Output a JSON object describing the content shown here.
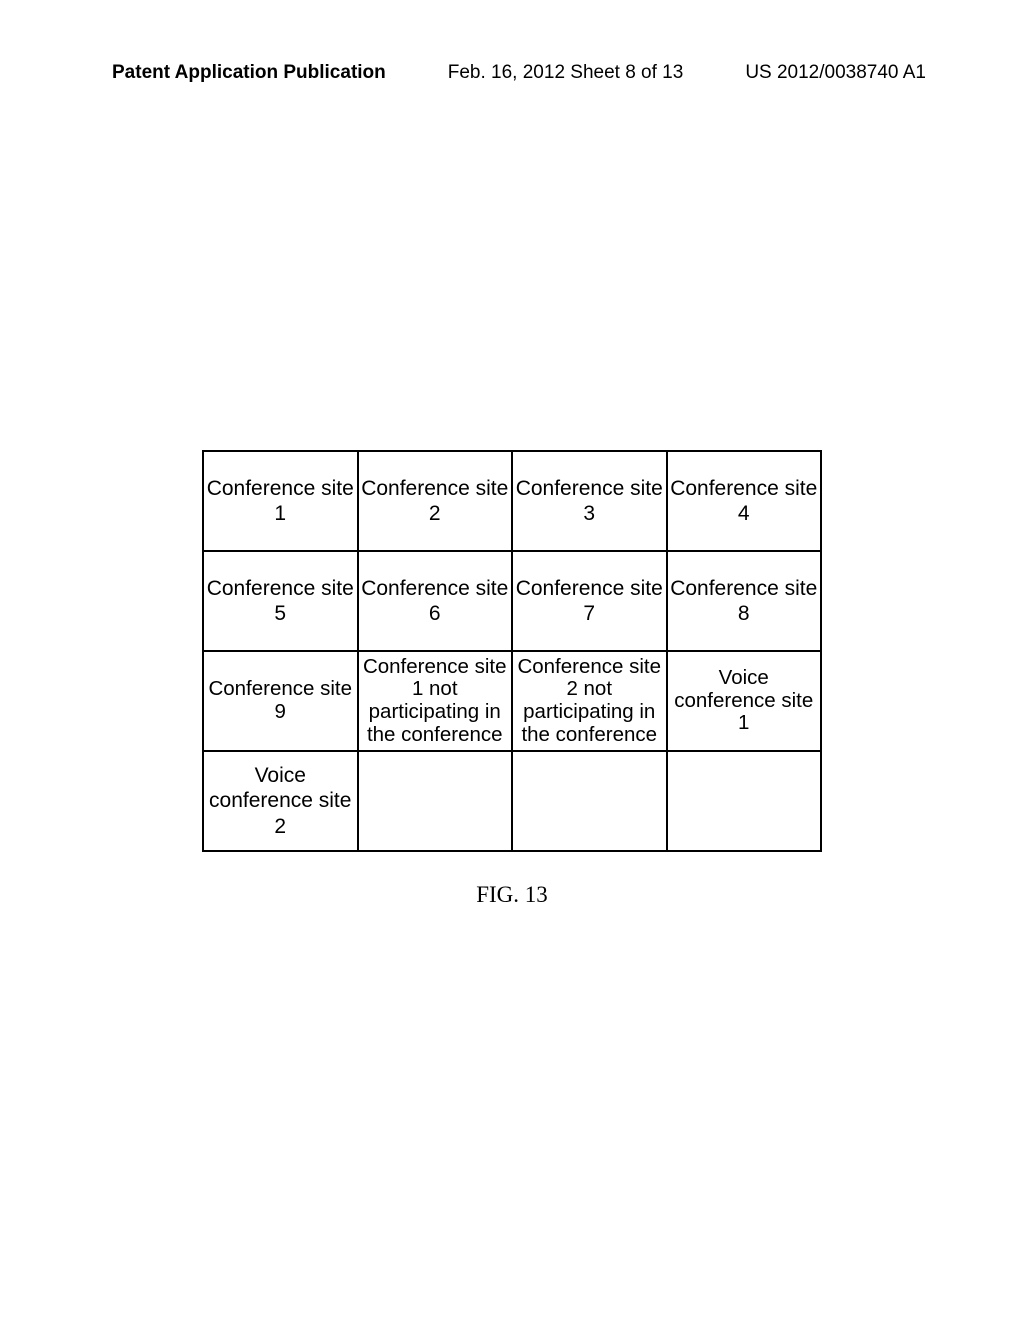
{
  "header": {
    "left": "Patent Application Publication",
    "center": "Feb. 16, 2012  Sheet 8 of 13",
    "right": "US 2012/0038740 A1"
  },
  "grid": {
    "rows": [
      [
        "Conference site 1",
        "Conference site 2",
        "Conference site 3",
        "Conference site 4"
      ],
      [
        "Conference site 5",
        "Conference site 6",
        "Conference site 7",
        "Conference site 8"
      ],
      [
        "Conference site 9",
        "Conference site 1 not participating in the conference",
        "Conference site 2 not participating in the conference",
        "Voice conference site 1"
      ],
      [
        "Voice conference site 2",
        "",
        "",
        ""
      ]
    ]
  },
  "figure_label": "FIG. 13"
}
